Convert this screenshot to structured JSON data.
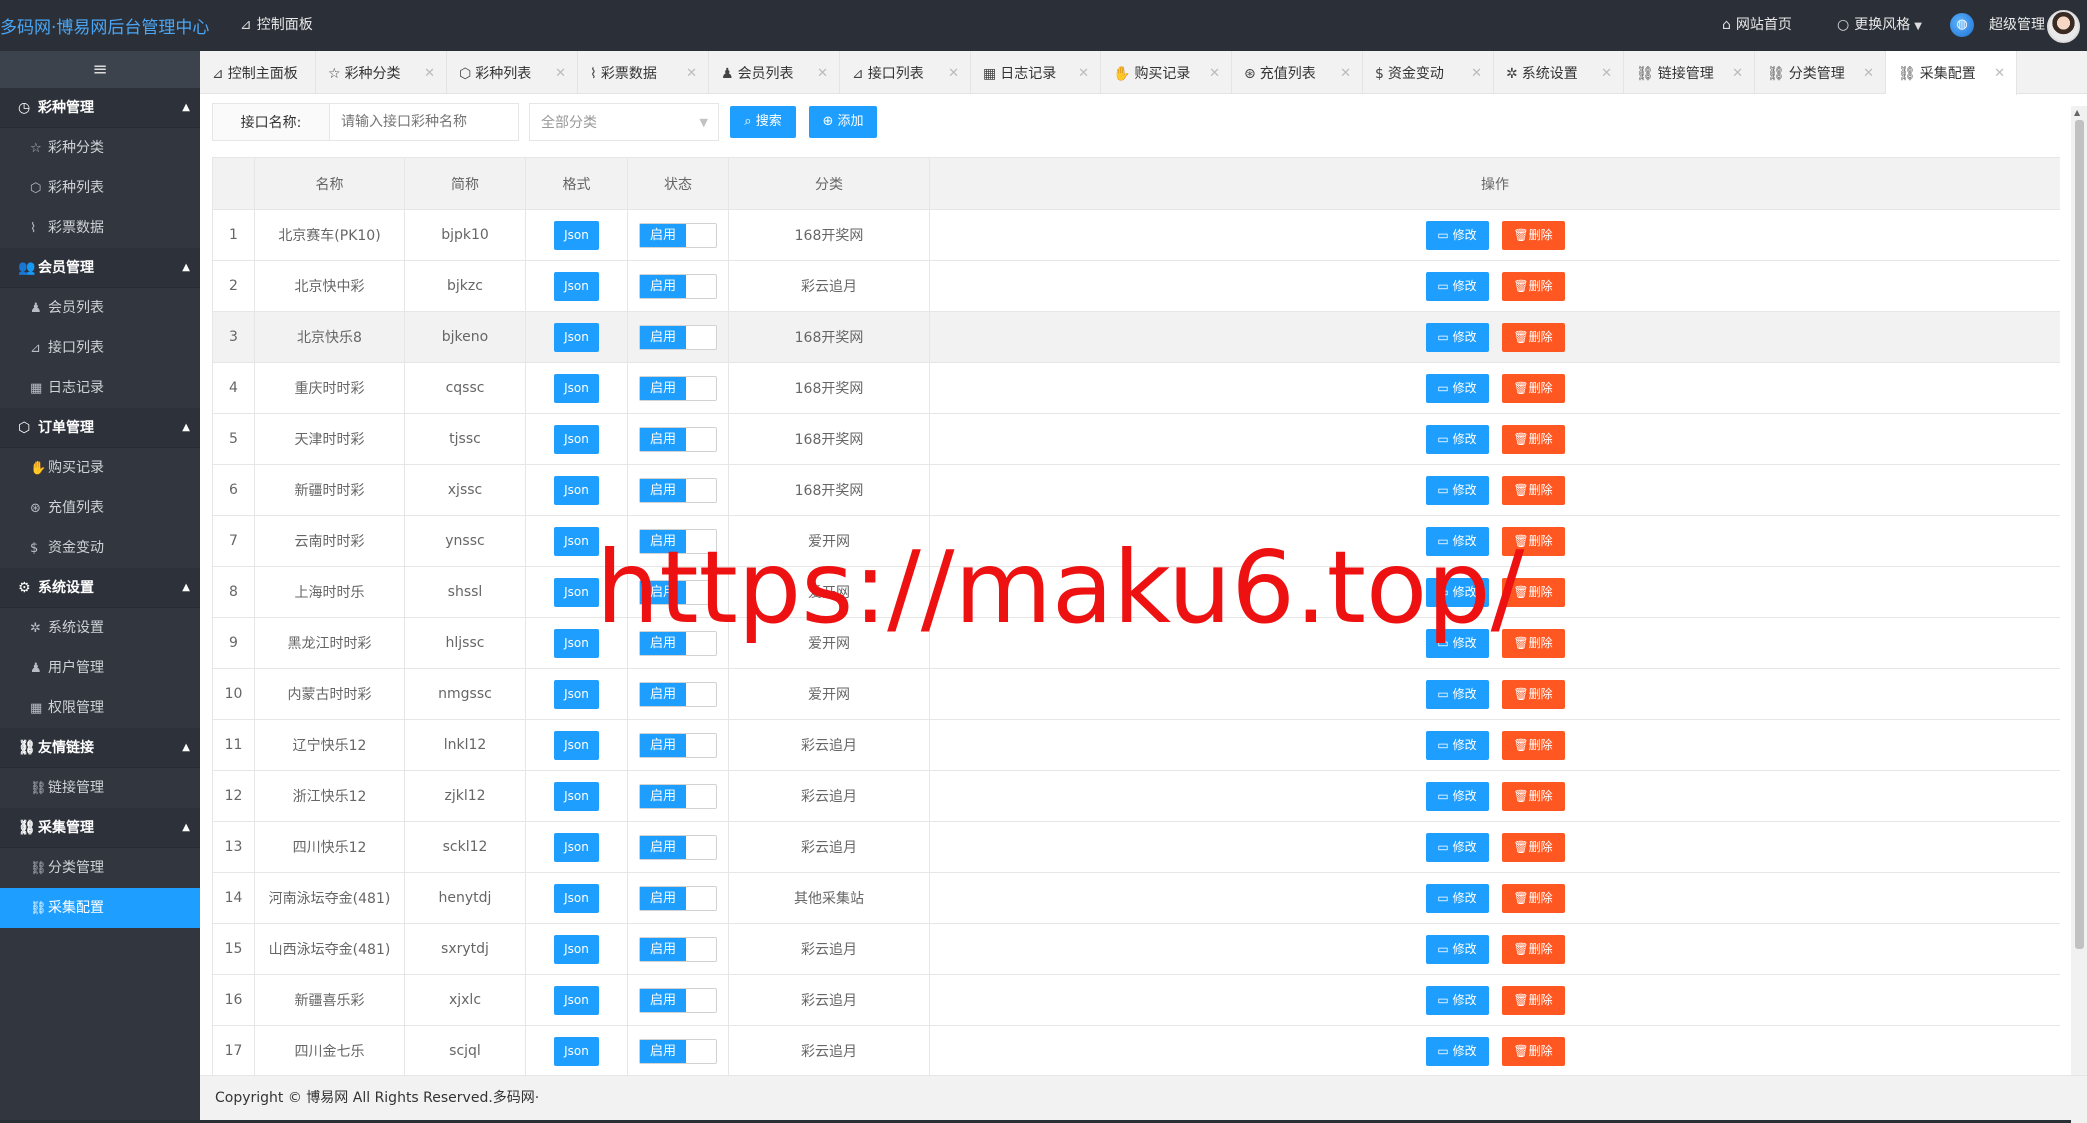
{
  "header": {
    "brand": "多码网·博易网后台管理中心",
    "dashboard": "控制面板",
    "home": "网站首页",
    "theme": "更换风格",
    "user": "超级管理"
  },
  "sidebar": {
    "toggle_icon": "menu-icon",
    "groups": [
      {
        "label": "彩种管理",
        "icon": "clock-icon",
        "items": [
          {
            "label": "彩种分类",
            "icon": "star-icon"
          },
          {
            "label": "彩种列表",
            "icon": "cube-icon"
          },
          {
            "label": "彩票数据",
            "icon": "pulse-icon"
          }
        ]
      },
      {
        "label": "会员管理",
        "icon": "users-icon",
        "items": [
          {
            "label": "会员列表",
            "icon": "user-icon"
          },
          {
            "label": "接口列表",
            "icon": "send-icon"
          },
          {
            "label": "日志记录",
            "icon": "calendar-icon"
          }
        ]
      },
      {
        "label": "订单管理",
        "icon": "cube-icon",
        "items": [
          {
            "label": "购买记录",
            "icon": "hand-icon"
          },
          {
            "label": "充值列表",
            "icon": "coin-icon"
          },
          {
            "label": "资金变动",
            "icon": "dollar-icon"
          }
        ]
      },
      {
        "label": "系统设置",
        "icon": "gear-icon",
        "items": [
          {
            "label": "系统设置",
            "icon": "wrench-icon"
          },
          {
            "label": "用户管理",
            "icon": "user-icon"
          },
          {
            "label": "权限管理",
            "icon": "calendar-icon"
          }
        ]
      },
      {
        "label": "友情链接",
        "icon": "link-icon",
        "items": [
          {
            "label": "链接管理",
            "icon": "link-icon"
          }
        ]
      },
      {
        "label": "采集管理",
        "icon": "link-icon",
        "items": [
          {
            "label": "分类管理",
            "icon": "link-icon"
          },
          {
            "label": "采集配置",
            "icon": "link-icon"
          }
        ]
      }
    ]
  },
  "tabs": [
    {
      "label": "控制主面板"
    },
    {
      "label": "彩种分类"
    },
    {
      "label": "彩种列表"
    },
    {
      "label": "彩票数据"
    },
    {
      "label": "会员列表"
    },
    {
      "label": "接口列表"
    },
    {
      "label": "日志记录"
    },
    {
      "label": "购买记录"
    },
    {
      "label": "充值列表"
    },
    {
      "label": "资金变动"
    },
    {
      "label": "系统设置"
    },
    {
      "label": "链接管理"
    },
    {
      "label": "分类管理"
    },
    {
      "label": "采集配置"
    }
  ],
  "toolbar": {
    "name_label": "接口名称:",
    "name_placeholder": "请输入接口彩种名称",
    "category_select": "全部分类",
    "search_label": "搜索",
    "add_label": "添加"
  },
  "table": {
    "columns": [
      "",
      "名称",
      "简称",
      "格式",
      "状态",
      "分类",
      "操作"
    ],
    "format_label": "Json",
    "status_label": "启用",
    "edit_label": "修改",
    "delete_label": "删除",
    "rows": [
      {
        "id": "1",
        "name": "北京赛车(PK10)",
        "code": "bjpk10",
        "category": "168开奖网"
      },
      {
        "id": "2",
        "name": "北京快中彩",
        "code": "bjkzc",
        "category": "彩云追月"
      },
      {
        "id": "3",
        "name": "北京快乐8",
        "code": "bjkeno",
        "category": "168开奖网"
      },
      {
        "id": "4",
        "name": "重庆时时彩",
        "code": "cqssc",
        "category": "168开奖网"
      },
      {
        "id": "5",
        "name": "天津时时彩",
        "code": "tjssc",
        "category": "168开奖网"
      },
      {
        "id": "6",
        "name": "新疆时时彩",
        "code": "xjssc",
        "category": "168开奖网"
      },
      {
        "id": "7",
        "name": "云南时时彩",
        "code": "ynssc",
        "category": "爱开网"
      },
      {
        "id": "8",
        "name": "上海时时乐",
        "code": "shssl",
        "category": "爱开网"
      },
      {
        "id": "9",
        "name": "黑龙江时时彩",
        "code": "hljssc",
        "category": "爱开网"
      },
      {
        "id": "10",
        "name": "内蒙古时时彩",
        "code": "nmgssc",
        "category": "爱开网"
      },
      {
        "id": "11",
        "name": "辽宁快乐12",
        "code": "lnkl12",
        "category": "彩云追月"
      },
      {
        "id": "12",
        "name": "浙江快乐12",
        "code": "zjkl12",
        "category": "彩云追月"
      },
      {
        "id": "13",
        "name": "四川快乐12",
        "code": "sckl12",
        "category": "彩云追月"
      },
      {
        "id": "14",
        "name": "河南泳坛夺金(481)",
        "code": "henytdj",
        "category": "其他采集站"
      },
      {
        "id": "15",
        "name": "山西泳坛夺金(481)",
        "code": "sxrytdj",
        "category": "彩云追月"
      },
      {
        "id": "16",
        "name": "新疆喜乐彩",
        "code": "xjxlc",
        "category": "彩云追月"
      },
      {
        "id": "17",
        "name": "四川金七乐",
        "code": "scjql",
        "category": "彩云追月"
      }
    ]
  },
  "footer": "Copyright © 博易网 All Rights Reserved.多码网·",
  "watermark": "https://maku6.top/",
  "colors": {
    "accent": "#1e9fff",
    "danger": "#ff5722",
    "sidebar": "#32373f",
    "topbar": "#2b3038"
  }
}
